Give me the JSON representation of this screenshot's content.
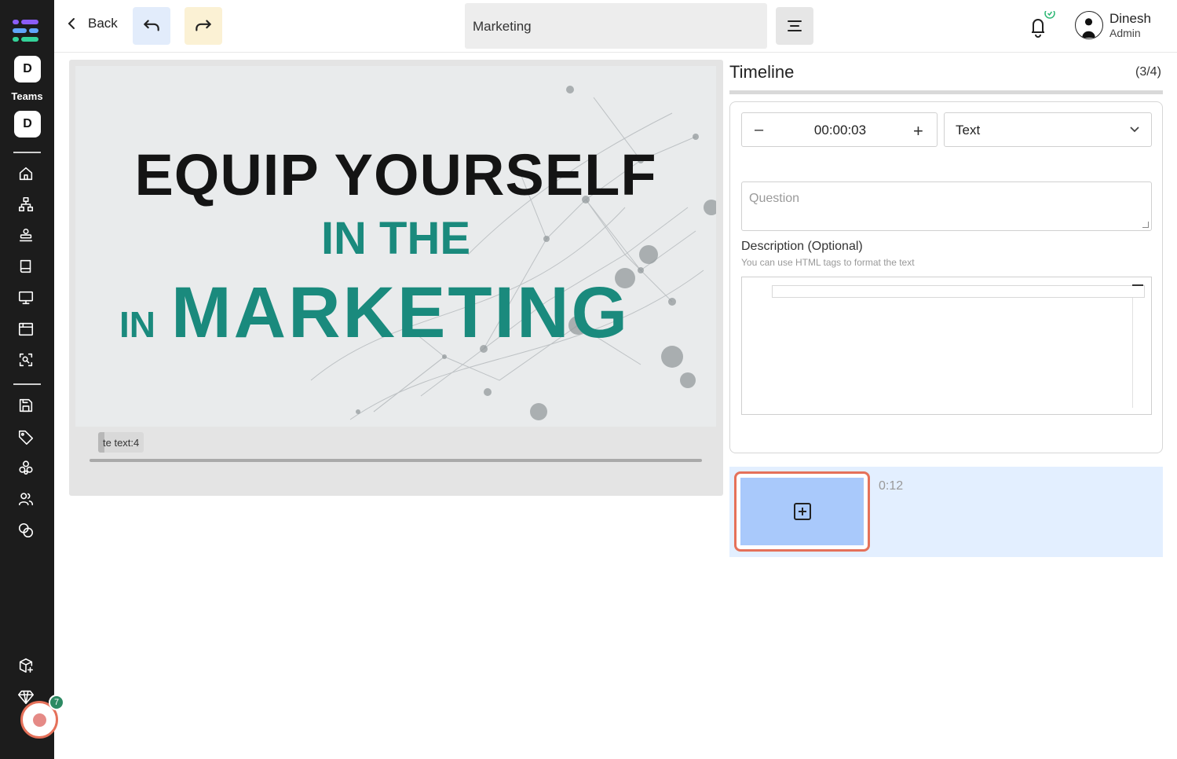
{
  "sidebar": {
    "workspace_initial_1": "D",
    "teams_label": "Teams",
    "workspace_initial_2": "D",
    "notification_count": "7",
    "icons": [
      "home-icon",
      "hierarchy-icon",
      "stack-icon",
      "book-icon",
      "monitor-icon",
      "browser-icon",
      "scan-search-icon",
      "save-icon",
      "tag-icon",
      "cluster-icon",
      "users-icon",
      "coins-icon",
      "package-plus-icon",
      "gem-icon"
    ]
  },
  "topbar": {
    "back_label": "Back",
    "project_title": "Marketing",
    "undo_bg": "#e2ecfb",
    "redo_bg": "#fbf1d4",
    "user_name": "Dinesh",
    "user_role": "Admin"
  },
  "slide": {
    "line1": "EQUIP YOURSELF",
    "line2": "IN THE",
    "line3_small": "IN",
    "line3_big": "MARKETING",
    "accent_color": "#1a8a7d"
  },
  "player": {
    "chip_label": "te text:4"
  },
  "timeline": {
    "title": "Timeline",
    "count": "(3/4)",
    "time_minus": "–",
    "time_value": "00:00:03",
    "time_plus": "+",
    "type_selected": "Text",
    "question_placeholder": "Question",
    "description_label": "Description (Optional)",
    "description_hint": "You can use HTML tags to format the text",
    "duration": "0:12"
  }
}
